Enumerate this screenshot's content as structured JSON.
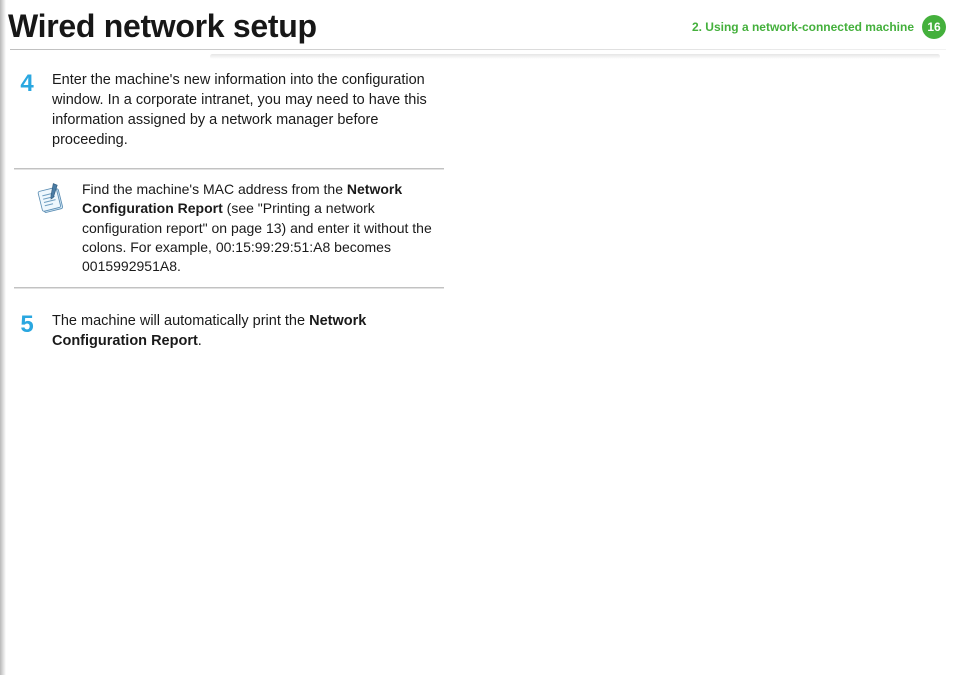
{
  "header": {
    "title": "Wired network setup",
    "chapter": "2.  Using a network-connected machine",
    "page": "16"
  },
  "steps": {
    "s4": {
      "num": "4",
      "text": "Enter the machine's new information into the configuration window. In a corporate intranet, you may need to have this information assigned by a network manager before proceeding."
    },
    "s5": {
      "num": "5",
      "pre": "The machine will automatically print the ",
      "bold": "Network Configuration Report",
      "post": "."
    }
  },
  "note": {
    "pre": "Find the machine's MAC address from the ",
    "bold": "Network Configuration Report",
    "post": " (see \"Printing a network configuration report\" on page 13) and enter it without the colons. For example, 00:15:99:29:51:A8 becomes 0015992951A8."
  }
}
